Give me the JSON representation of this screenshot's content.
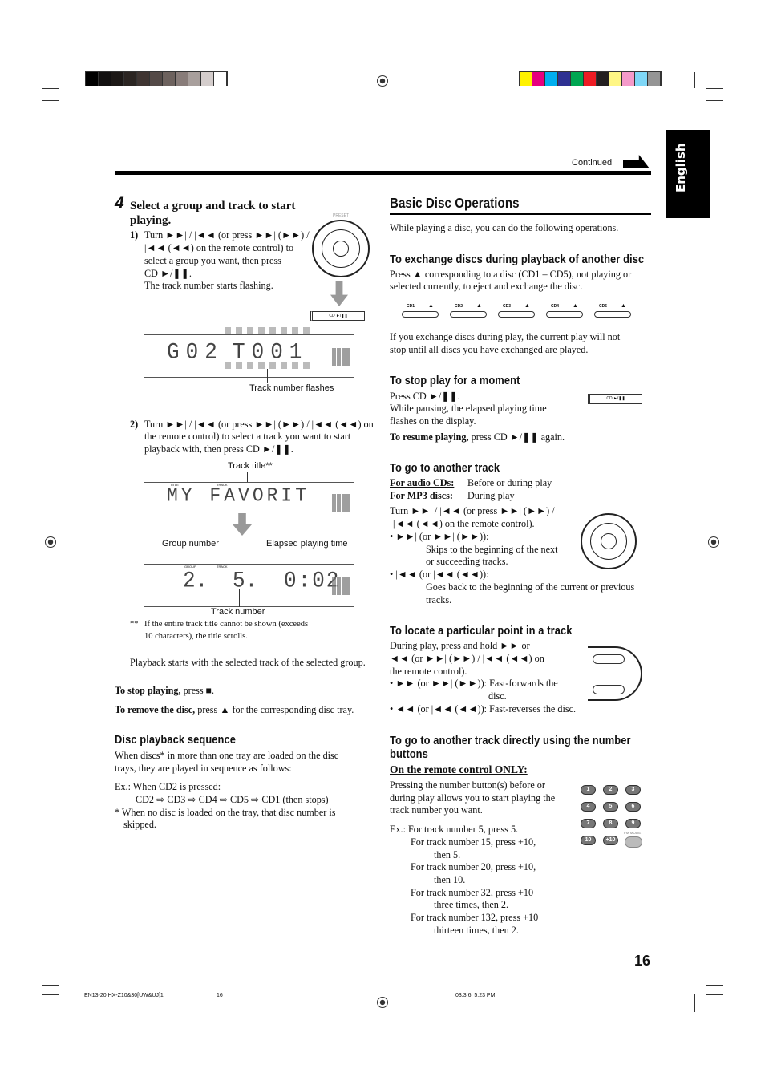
{
  "colors": {
    "gray_bar": [
      "#000000",
      "#121010",
      "#1c1816",
      "#2b2522",
      "#3f3532",
      "#544a47",
      "#6d625e",
      "#887c79",
      "#a89f9c",
      "#d4cdcc",
      "#ffffff"
    ],
    "color_bar": [
      "#fff200",
      "#e6007e",
      "#00aeef",
      "#2e3192",
      "#00a651",
      "#ed1c24",
      "#231f20",
      "#fff685",
      "#f49ac9",
      "#7fd7f7",
      "#959595"
    ]
  },
  "header": {
    "continued": "Continued",
    "tab": "English"
  },
  "left": {
    "step_num": "4",
    "step_title": [
      "Select a group and track to start",
      "playing."
    ],
    "sub1_num": "1)",
    "sub1": [
      "Turn ►►| / |◄◄ (or press ►►| (►►) /",
      "|◄◄ (◄◄) on the remote control) to",
      "select a group you want, then press",
      "CD ►/❚❚.",
      "The track number starts flashing."
    ],
    "display1": {
      "group": "G02",
      "track": "T001",
      "caption": "Track number flashes"
    },
    "sub2_num": "2)",
    "sub2": [
      "Turn ►►| / |◄◄ (or press ►►| (►►) / |◄◄ (◄◄) on",
      "the remote control) to select a track you want to start",
      "playback with, then press CD ►/❚❚."
    ],
    "display2": {
      "caption": "Track title**",
      "text": "MY FAVORIT",
      "label_title": "TITLE",
      "label_track": "TRACK"
    },
    "display3": {
      "group_caption": "Group number",
      "time_caption": "Elapsed playing time",
      "track_caption": "Track number",
      "group": "2.",
      "track": "5.",
      "time": "0:02",
      "label_group": "GROUP",
      "label_track": "TRACK"
    },
    "footnote_mark": "**",
    "footnote": [
      "If the entire track title cannot be shown (exceeds",
      "10 characters), the title scrolls."
    ],
    "playback_note": "Playback starts with the selected track of the selected group.",
    "stop_bold": "To stop playing,",
    "stop_rest": " press ■.",
    "remove_bold": "To remove the disc,",
    "remove_rest": " press ▲ for the corresponding disc tray.",
    "seq_heading": "Disc playback sequence",
    "seq": [
      "When discs* in more than one tray are loaded on the disc",
      "trays, they are played in sequence as follows:",
      "Ex.:  When CD2 is pressed:",
      "CD2 ⇨ CD3 ⇨ CD4 ⇨ CD5 ⇨ CD1 (then stops)",
      "*  When no disc is loaded on the tray, that disc number is",
      "skipped."
    ]
  },
  "right": {
    "title": "Basic Disc Operations",
    "intro": "While playing a disc, you can do the following operations.",
    "exchange_heading": "To exchange discs during playback of another disc",
    "exchange": [
      "Press ▲ corresponding to a disc (CD1 – CD5), not playing or",
      "selected currently, to eject and exchange the disc."
    ],
    "cd_buttons": [
      "CD1",
      "CD2",
      "CD3",
      "CD4",
      "CD5"
    ],
    "exchange_note": [
      "If you exchange discs during play, the current play will not",
      "stop until all discs you have exchanged are played."
    ],
    "pause_heading": "To stop play for a moment",
    "pause": [
      "Press CD ►/❚❚.",
      "While pausing, the elapsed playing time",
      "flashes on the display."
    ],
    "resume_bold": "To resume playing,",
    "resume_rest": " press CD ►/❚❚ again.",
    "cd_button_label": "CD ►/❚❚",
    "another_heading": "To go to another track",
    "audio_label": "For audio CDs:",
    "audio_text": "Before or during play",
    "mp3_label": "For MP3 discs:",
    "mp3_text": "During play",
    "another": [
      "Turn ►►| / |◄◄ (or press ►►| (►►) /",
      "|◄◄ (◄◄) on the remote control).",
      "• ►►| (or ►►| (►►)):",
      "Skips to the beginning of the next",
      "or succeeding tracks.",
      "• |◄◄ (or |◄◄ (◄◄)):",
      "Goes back to the beginning of the current or previous",
      "tracks."
    ],
    "dial_labels": {
      "preset": "PRESET",
      "minus": "−",
      "plus": "+"
    },
    "locate_heading": "To locate a particular point in a track",
    "locate": [
      "During play, press and hold ►► or",
      "◄◄ (or ►►| (►►) / |◄◄ (◄◄) on",
      "the remote control).",
      "• ►► (or ►►| (►►)):  Fast-forwards the",
      "disc.",
      "• ◄◄ (or |◄◄ (◄◄)):  Fast-reverses the disc."
    ],
    "direct_heading": [
      "To go to another track directly using the number",
      "buttons"
    ],
    "remote_only": "On the remote control ONLY:",
    "direct": [
      "Pressing the number button(s) before or",
      "during play allows you to start playing the",
      "track number you want."
    ],
    "examples": [
      "Ex.:  For track number 5, press 5.",
      "For track number 15, press +10,",
      "then 5.",
      "For track number 20, press +10,",
      "then 10.",
      "For track number 32, press +10",
      "three times, then 2.",
      "For track number 132, press +10",
      "thirteen times, then 2."
    ],
    "keys": [
      "1",
      "2",
      "3",
      "4",
      "5",
      "6",
      "7",
      "8",
      "9",
      "10",
      "+10"
    ],
    "fm_mode": "FM MODE"
  },
  "page_number": "16",
  "footer": {
    "file": "EN13-20.HX-Z10&30[UW&UJ]1",
    "page": "16",
    "date": "03.3.6, 5:23 PM"
  }
}
